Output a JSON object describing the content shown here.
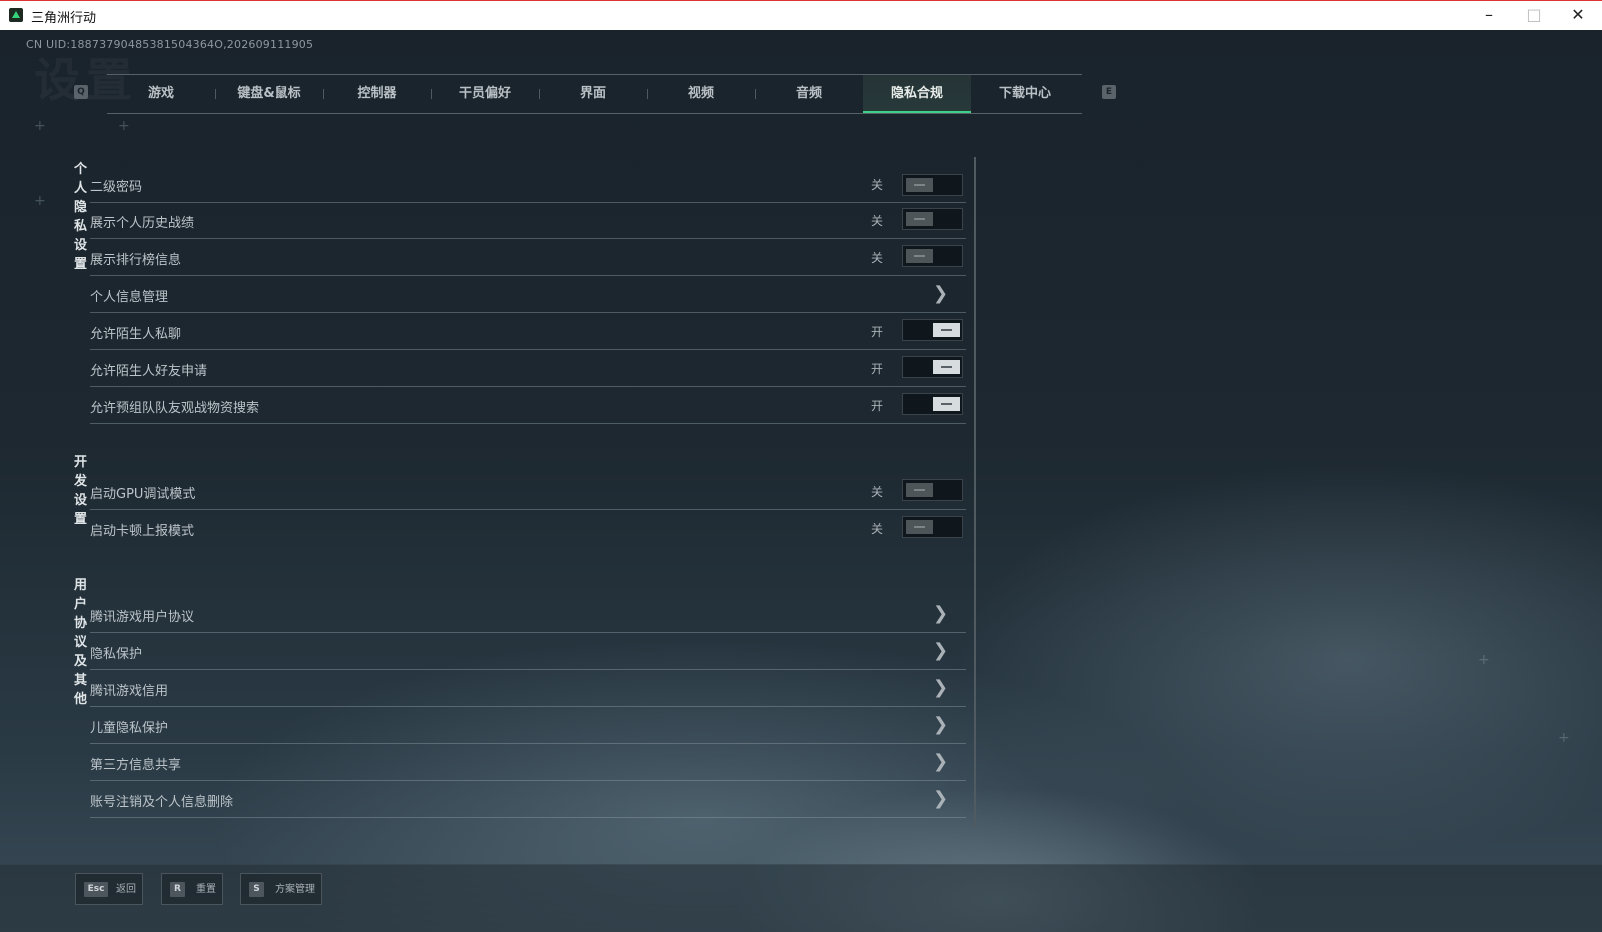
{
  "window": {
    "title": "三角洲行动",
    "minimize": "–",
    "maximize": "□",
    "close": "✕"
  },
  "header": {
    "uid": "CN UID:18873790485381504364Ο,202609111905",
    "page_title": "设置"
  },
  "tabs": {
    "prev_key": "Q",
    "next_key": "E",
    "items": [
      "游戏",
      "键盘&鼠标",
      "控制器",
      "干员偏好",
      "界面",
      "视频",
      "音频",
      "隐私合规",
      "下载中心"
    ],
    "active": "隐私合规"
  },
  "sections": {
    "privacy": {
      "title": "个人隐私设置",
      "rows": [
        {
          "label": "二级密码",
          "state": "关",
          "on": false
        },
        {
          "label": "展示个人历史战绩",
          "state": "关",
          "on": false
        },
        {
          "label": "展示排行榜信息",
          "state": "关",
          "on": false
        },
        {
          "label": "个人信息管理",
          "link": true
        },
        {
          "label": "允许陌生人私聊",
          "state": "开",
          "on": true
        },
        {
          "label": "允许陌生人好友申请",
          "state": "开",
          "on": true
        },
        {
          "label": "允许预组队队友观战物资搜索",
          "state": "开",
          "on": true
        }
      ]
    },
    "dev": {
      "title": "开发设置",
      "rows": [
        {
          "label": "启动GPU调试模式",
          "state": "关",
          "on": false
        },
        {
          "label": "启动卡顿上报模式",
          "state": "关",
          "on": false
        }
      ]
    },
    "agreements": {
      "title": "用户协议及其他",
      "rows": [
        {
          "label": "腾讯游戏用户协议"
        },
        {
          "label": "隐私保护"
        },
        {
          "label": "腾讯游戏信用"
        },
        {
          "label": "儿童隐私保护"
        },
        {
          "label": "第三方信息共享"
        },
        {
          "label": "账号注销及个人信息删除"
        }
      ]
    }
  },
  "footer": {
    "back": {
      "key": "Esc",
      "label": "返回"
    },
    "reset": {
      "key": "R",
      "label": "重置"
    },
    "scheme": {
      "key": "S",
      "label": "方案管理"
    }
  },
  "icons": {
    "chevron": "chevron-right-icon",
    "toggle_on_color": "#d7dcdf",
    "accent": "#3fd18a"
  }
}
